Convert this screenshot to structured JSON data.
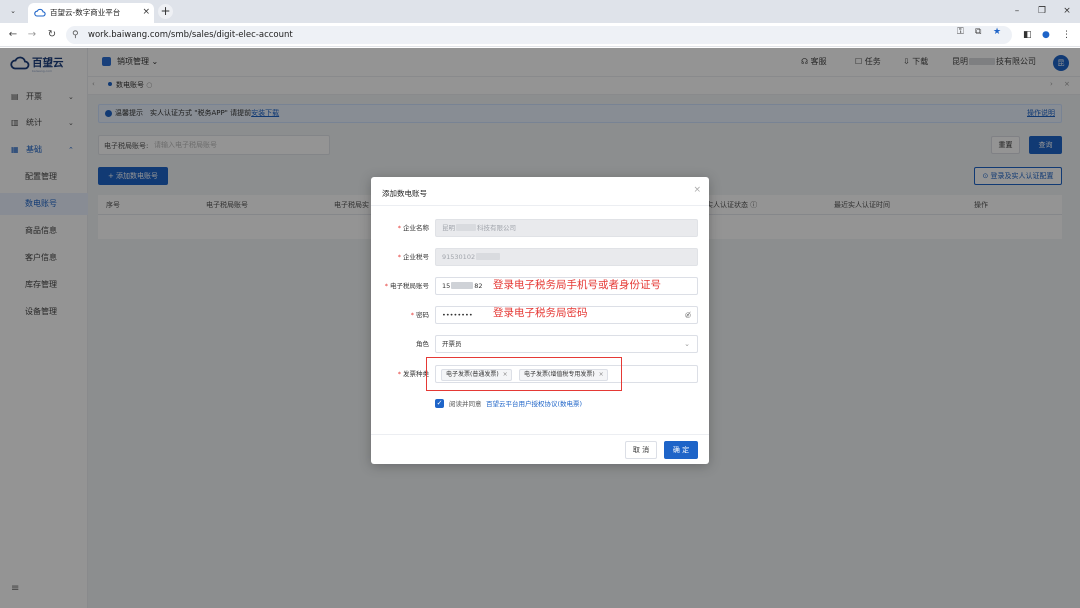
{
  "browser": {
    "tab_title": "百望云-数字商业平台",
    "url": "work.baiwang.com/smb/sales/digit-elec-account"
  },
  "app": {
    "logo_text": "百望云",
    "logo_sub": "baiwang.com",
    "store": "销项管理",
    "topbar": {
      "service": "客服",
      "tasks": "任务",
      "download": "下载",
      "company_prefix": "昆明",
      "company_suffix": "技有限公司",
      "avatar": "昆"
    },
    "sidebar": {
      "items": [
        {
          "label": "开票",
          "icon": "▤"
        },
        {
          "label": "统计",
          "icon": "▥"
        },
        {
          "label": "基础",
          "icon": "▦"
        }
      ],
      "sub_items": [
        "配置管理",
        "数电账号",
        "商品信息",
        "客户信息",
        "库存管理",
        "设备管理"
      ]
    },
    "tag": "数电账号",
    "notice": {
      "text": "温馨提示　实人认证方式 \"税务APP\" 请提前",
      "link": "安装下载",
      "manual": "操作说明"
    },
    "search": {
      "label": "电子税局账号:",
      "placeholder": "请输入电子税局账号"
    },
    "buttons": {
      "reset": "重置",
      "query": "查询",
      "add": "+ 添加数电账号",
      "login_config": "⊙ 登录及实人认证配置"
    },
    "table_headers": [
      "序号",
      "电子税局账号",
      "电子税局实",
      "实人认证状态 ⓘ",
      "最近实人认证时间",
      "操作"
    ]
  },
  "modal": {
    "title": "添加数电账号",
    "fields": {
      "company_name": {
        "label": "企业名称",
        "value_prefix": "昆明",
        "value_suffix": "科技有限公司"
      },
      "tax_no": {
        "label": "企业税号",
        "value_prefix": "91530102"
      },
      "account": {
        "label": "电子税局账号",
        "value_prefix": "15",
        "value_suffix": "82"
      },
      "password": {
        "label": "密码",
        "value": "••••••••"
      },
      "role": {
        "label": "角色",
        "value": "开票员"
      },
      "invoice_type": {
        "label": "发票种类",
        "chips": [
          "电子发票(普通发票)",
          "电子发票(增值税专用发票)"
        ]
      }
    },
    "annotations": {
      "account_note": "登录电子税务局手机号或者身份证号",
      "password_note": "登录电子税务局密码"
    },
    "agree_text": "阅读并同意",
    "agree_link": "百望云平台用户授权协议(数电票)",
    "cancel": "取 消",
    "confirm": "确 定"
  },
  "colors": {
    "primary": "#1e64c8",
    "annotation_red": "#e53935"
  }
}
